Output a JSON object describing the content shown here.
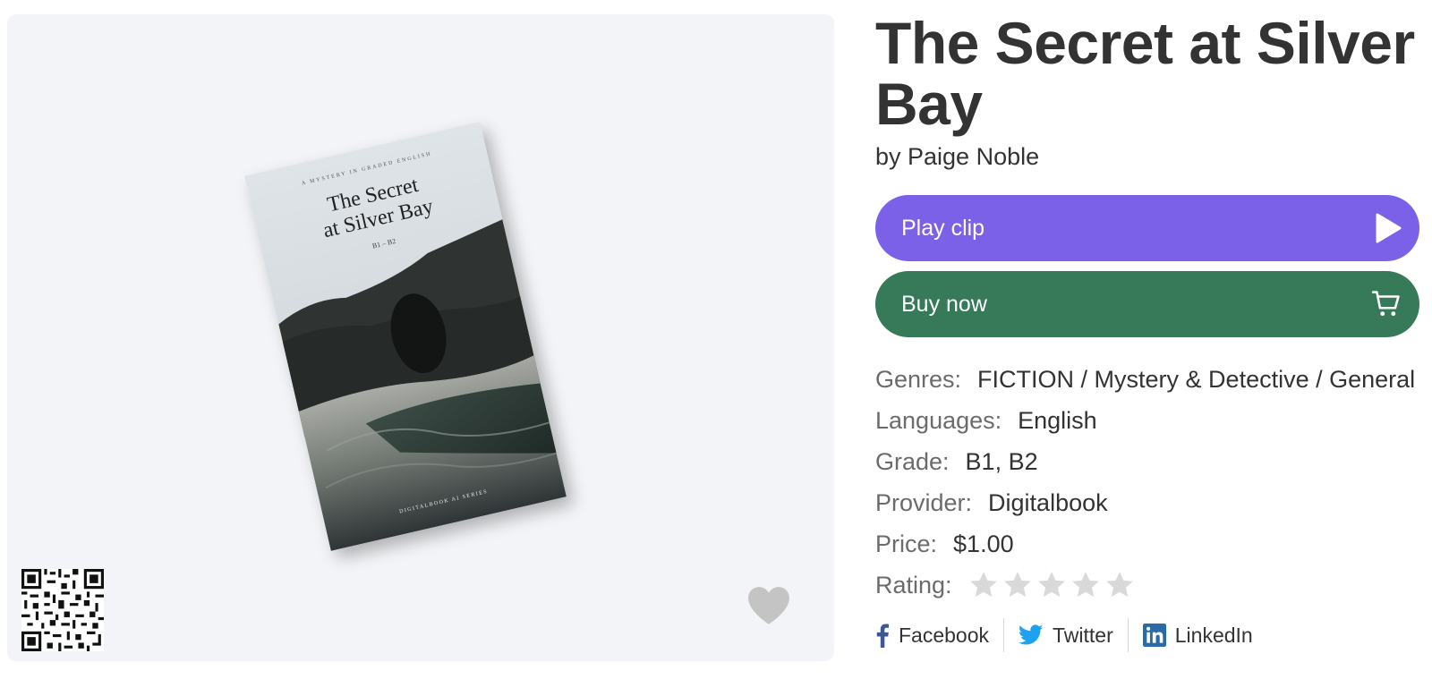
{
  "book": {
    "title": "The Secret at Silver Bay",
    "author_line": "by Paige Noble"
  },
  "cover": {
    "kicker": "A MYSTERY IN GRADED ENGLISH",
    "title_line1": "The Secret",
    "title_line2": "at Silver Bay",
    "level": "B1 – B2",
    "series": "DIGITALBOOK AI SERIES"
  },
  "actions": {
    "play_label": "Play clip",
    "buy_label": "Buy now",
    "play_color": "#7b61e8",
    "buy_color": "#367a5a"
  },
  "details": {
    "genres_label": "Genres:",
    "genres_value": "FICTION / Mystery & Detective / General",
    "languages_label": "Languages:",
    "languages_value": "English",
    "grade_label": "Grade:",
    "grade_value": "B1, B2",
    "provider_label": "Provider:",
    "provider_value": "Digitalbook",
    "price_label": "Price:",
    "price_value": "$1.00",
    "rating_label": "Rating:",
    "rating_value": 0,
    "rating_max": 5
  },
  "share": {
    "facebook": "Facebook",
    "twitter": "Twitter",
    "linkedin": "LinkedIn",
    "facebook_color": "#3b5998",
    "twitter_color": "#1da1f2",
    "linkedin_color": "#2a6aa8"
  },
  "icons": {
    "play": "play-icon",
    "cart": "cart-icon",
    "heart": "heart-icon",
    "qr": "qr-code-icon",
    "star": "star-icon"
  }
}
